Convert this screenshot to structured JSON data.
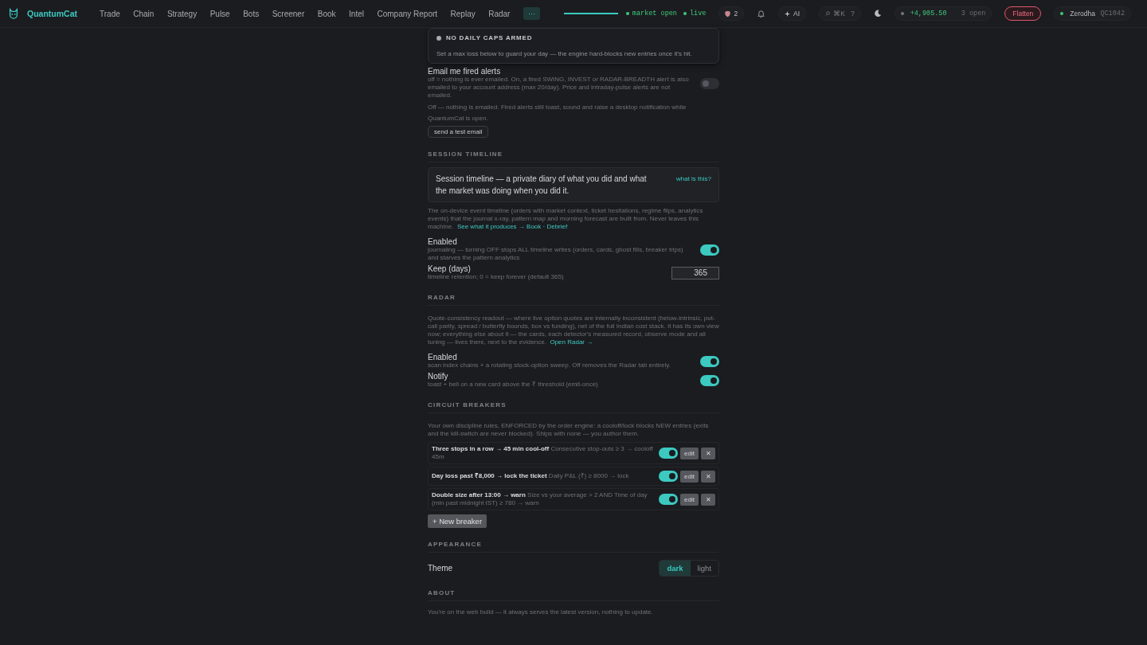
{
  "topbar": {
    "brand": "QuantumCat",
    "nav": [
      {
        "label": "Trade",
        "selected": false
      },
      {
        "label": "Chain",
        "selected": false
      },
      {
        "label": "Strategy",
        "selected": false
      },
      {
        "label": "Pulse",
        "selected": false
      },
      {
        "label": "Bots",
        "selected": false
      },
      {
        "label": "Screener",
        "selected": false
      },
      {
        "label": "Book",
        "selected": false
      },
      {
        "label": "Intel",
        "selected": false
      },
      {
        "label": "Company Report",
        "selected": false
      },
      {
        "label": "Replay",
        "selected": false
      },
      {
        "label": "Radar",
        "selected": false
      }
    ],
    "more": "···",
    "progress": {
      "level": 1
    },
    "market": "market open",
    "live": "live",
    "shield_count": "2",
    "ai": "AI",
    "shortcut": "⌘K",
    "help": "?",
    "pnl": "+4,905.50",
    "open_count": "3 open",
    "flatten": "Flatten",
    "broker": "Zerodha",
    "account": "QC1042"
  },
  "popup": {
    "title": "NO DAILY CAPS ARMED",
    "text": "Set a max loss below to guard your day — the engine hard-blocks new entries once it's hit."
  },
  "email": {
    "label": "Email me fired alerts",
    "desc": "off = nothing is ever emailed. On, a fired SWING, INVEST or RADAR-BREADTH alert is also emailed to your account address (max 20/day). Price and intraday-pulse alerts are not emailed.",
    "on": false,
    "note": "Off — nothing is emailed. Fired alerts still toast, sound and raise a desktop notification while QuantumCat is open.",
    "button": "send a test email"
  },
  "session": {
    "heading": "SESSION TIMELINE",
    "card_text": "Session timeline — a private diary of what you did and what the market was doing when you did it.",
    "card_link": "what is this?",
    "desc": "The on-device event timeline (orders with market context, ticket hesitations, regime flips, analytics events) that the journal x-ray, pattern map and morning forecast are built from. Never leaves this machine.",
    "link": "See what it produces → Book · Debrief",
    "settings": [
      {
        "kind": "toggle",
        "label": "Enabled",
        "desc": "journaling — turning OFF stops ALL timeline writes (orders, cards, ghost fills, breaker trips) and starves the pattern analytics",
        "on": true
      },
      {
        "kind": "number",
        "label": "Keep (days)",
        "desc": "timeline retention; 0 = keep forever (default 365)",
        "value": "365"
      }
    ]
  },
  "radar": {
    "heading": "RADAR",
    "desc": "Quote-consistency readout — where live option quotes are internally inconsistent (below-intrinsic, put-call parity, spread / butterfly bounds, box vs funding), net of the full Indian cost stack. It has its own view now; everything else about it — the cards, each detector's measured record, observe mode and all tuning — lives there, next to the evidence.",
    "link": "Open Radar →",
    "settings": [
      {
        "kind": "toggle",
        "label": "Enabled",
        "desc": "scan index chains + a rotating stock-option sweep. Off removes the Radar tab entirely.",
        "on": true
      },
      {
        "kind": "toggle",
        "label": "Notify",
        "desc": "toast + bell on a new card above the ₹ threshold (emit-once)",
        "on": true
      }
    ]
  },
  "breakers": {
    "heading": "CIRCUIT BREAKERS",
    "desc": "Your own discipline rules, ENFORCED by the order engine: a cooloff/lock blocks NEW entries (exits and the kill-switch are never blocked). Ships with none — you author them.",
    "items": [
      {
        "title": "Three stops in a row → 45 min cool-off",
        "rule": "Consecutive stop-outs ≥ 3 → cooloff 45m",
        "on": true,
        "edit": "edit",
        "remove": "✕"
      },
      {
        "title": "Day loss past ₹8,000 → lock the ticket",
        "rule": "Daily P&L (₹) ≥ 8000 → lock",
        "on": true,
        "edit": "edit",
        "remove": "✕"
      },
      {
        "title": "Double size after 13:00 → warn",
        "rule": "Size vs your average > 2 AND Time of day (min past midnight IST) ≥ 780 → warn",
        "on": true,
        "edit": "edit",
        "remove": "✕"
      }
    ],
    "new_button": "+ New breaker"
  },
  "appearance": {
    "heading": "APPEARANCE",
    "label": "Theme",
    "options": [
      {
        "label": "dark",
        "selected": true
      },
      {
        "label": "light",
        "selected": false
      }
    ]
  },
  "about": {
    "heading": "ABOUT",
    "text": "You're on the web build — it always serves the latest version, nothing to update."
  }
}
